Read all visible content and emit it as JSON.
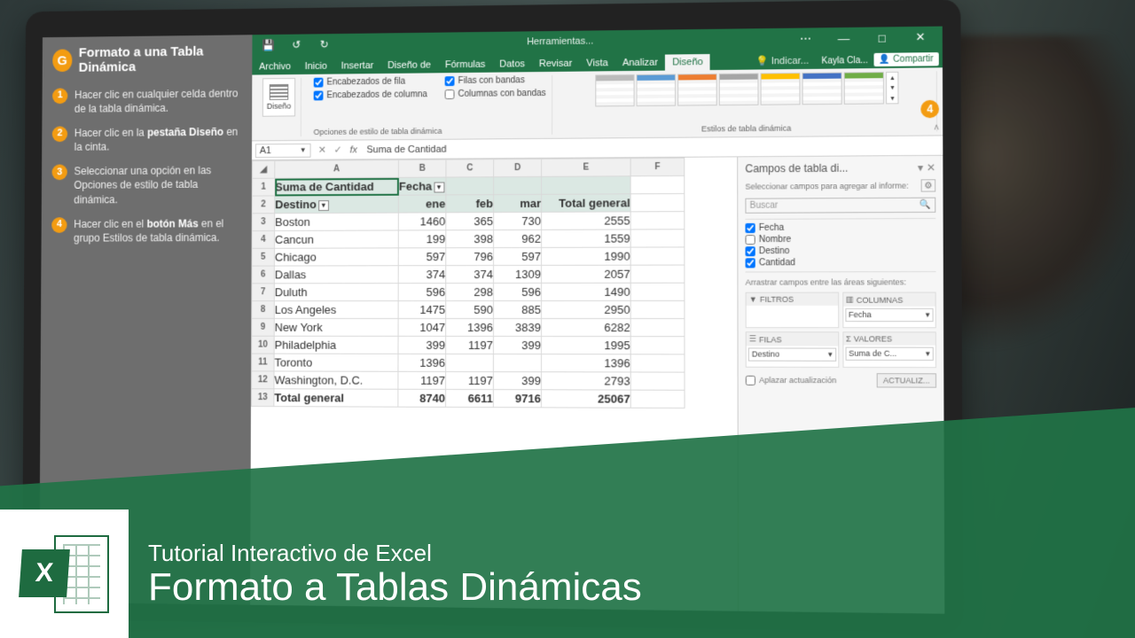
{
  "tutorial": {
    "title": "Formato a una Tabla Dinámica",
    "steps": [
      {
        "n": "1",
        "html": "Hacer clic en cualquier celda dentro de la tabla dinámica."
      },
      {
        "n": "2",
        "html": "Hacer clic en la <b>pestaña Diseño</b> en la cinta."
      },
      {
        "n": "3",
        "html": "Seleccionar una opción en las Opciones de estilo de tabla dinámica."
      },
      {
        "n": "4",
        "html": "Hacer clic en el <b>botón Más</b> en el grupo Estilos de tabla dinámica."
      }
    ]
  },
  "titlebar": {
    "context": "Herramientas..."
  },
  "tabs": {
    "items": [
      "Archivo",
      "Inicio",
      "Insertar",
      "Diseño de",
      "Fórmulas",
      "Datos",
      "Revisar",
      "Vista",
      "Analizar",
      "Diseño"
    ],
    "active": "Diseño",
    "tell": "Indicar...",
    "user": "Kayla Cla...",
    "share": "Compartir"
  },
  "ribbon": {
    "layoutBtn": "Diseño",
    "opts": {
      "rowHeaders": "Encabezados de fila",
      "colHeaders": "Encabezados de columna",
      "bandedRows": "Filas con bandas",
      "bandedCols": "Columnas con bandas",
      "groupLabel": "Opciones de estilo de tabla dinámica"
    },
    "stylesLabel": "Estilos de tabla dinámica",
    "badge": "4"
  },
  "formula": {
    "nameBox": "A1",
    "content": "Suma de Cantidad"
  },
  "grid": {
    "cols": [
      "A",
      "B",
      "C",
      "D",
      "E",
      "F"
    ],
    "h1": {
      "a": "Suma de Cantidad",
      "b": "Fecha"
    },
    "h2": {
      "a": "Destino",
      "b": "ene",
      "c": "feb",
      "d": "mar",
      "e": "Total general"
    },
    "rows": [
      {
        "dest": "Boston",
        "b": 1460,
        "c": 365,
        "d": 730,
        "e": 2555
      },
      {
        "dest": "Cancun",
        "b": 199,
        "c": 398,
        "d": 962,
        "e": 1559
      },
      {
        "dest": "Chicago",
        "b": 597,
        "c": 796,
        "d": 597,
        "e": 1990
      },
      {
        "dest": "Dallas",
        "b": 374,
        "c": 374,
        "d": 1309,
        "e": 2057
      },
      {
        "dest": "Duluth",
        "b": 596,
        "c": 298,
        "d": 596,
        "e": 1490
      },
      {
        "dest": "Los Angeles",
        "b": 1475,
        "c": 590,
        "d": 885,
        "e": 2950
      },
      {
        "dest": "New York",
        "b": 1047,
        "c": 1396,
        "d": 3839,
        "e": 6282
      },
      {
        "dest": "Philadelphia",
        "b": 399,
        "c": 1197,
        "d": 399,
        "e": 1995
      },
      {
        "dest": "Toronto",
        "b": 1396,
        "c": "",
        "d": "",
        "e": 1396
      },
      {
        "dest": "Washington, D.C.",
        "b": 1197,
        "c": 1197,
        "d": 399,
        "e": 2793
      }
    ],
    "total": {
      "label": "Total general",
      "b": 8740,
      "c": 6611,
      "d": 9716,
      "e": 25067
    }
  },
  "fieldPane": {
    "title": "Campos de tabla di...",
    "sub": "Seleccionar campos para agregar al informe:",
    "search": "Buscar",
    "fields": [
      {
        "name": "Fecha",
        "checked": true
      },
      {
        "name": "Nombre",
        "checked": false
      },
      {
        "name": "Destino",
        "checked": true
      },
      {
        "name": "Cantidad",
        "checked": true
      }
    ],
    "dragLabel": "Arrastrar campos entre las áreas siguientes:",
    "areas": {
      "filters": "FILTROS",
      "columns": "COLUMNAS",
      "rows": "FILAS",
      "values": "VALORES",
      "colChip": "Fecha",
      "rowChip": "Destino",
      "valChip": "Suma de C..."
    },
    "defer": "Aplazar actualización",
    "update": "ACTUALIZ..."
  },
  "banner": {
    "line1": "Tutorial Interactivo de Excel",
    "line2": "Formato a Tablas Dinámicas"
  }
}
